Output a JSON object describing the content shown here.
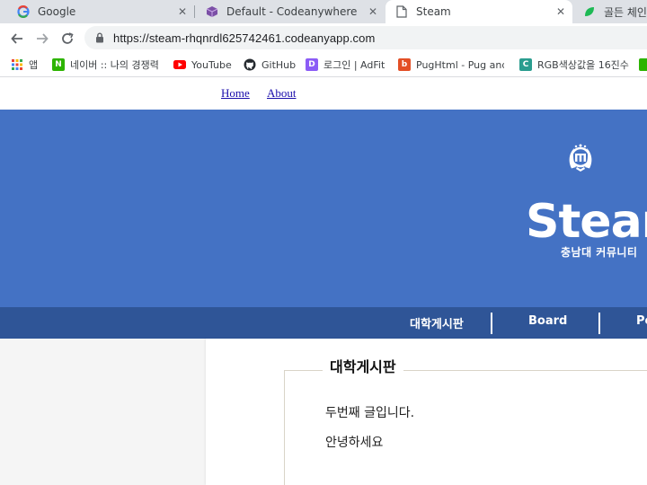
{
  "browser": {
    "tabs": [
      {
        "title": "Google",
        "favicon": "google-icon"
      },
      {
        "title": "Default - Codeanywhere",
        "favicon": "codeanywhere-cube-icon"
      },
      {
        "title": "Steam",
        "favicon": "document-icon",
        "active": true
      },
      {
        "title": "골든 체인지",
        "favicon": "green-leaf-icon"
      }
    ],
    "close_glyph": "✕",
    "url": "https://steam-rhqnrdl625742461.codeanyapp.com",
    "bookmarks": [
      {
        "label": "앱",
        "icon": "apps-grid-icon"
      },
      {
        "label": "네이버 :: 나의 경쟁력",
        "icon": "naver-icon",
        "icon_text": "N",
        "color": "#2db400"
      },
      {
        "label": "YouTube",
        "icon": "youtube-icon",
        "color": "#ff0000"
      },
      {
        "label": "GitHub",
        "icon": "github-icon",
        "color": "#24292e"
      },
      {
        "label": "로그인 | AdFit",
        "icon": "adfit-icon",
        "icon_text": "D",
        "color": "#8b5cf6"
      },
      {
        "label": "PugHtml - Pug and",
        "icon": "pughtml-icon",
        "icon_text": "b",
        "color": "#e34f26"
      },
      {
        "label": "RGB색상값을 16진수",
        "icon": "rgb-converter-icon",
        "icon_text": "C",
        "color": "#2a9d8f"
      }
    ]
  },
  "site": {
    "top_nav": [
      {
        "label": "Home"
      },
      {
        "label": "About"
      }
    ],
    "logo": {
      "title": "Steam",
      "subtitle": "충남대 커뮤니티",
      "emblem_text": "m"
    },
    "menu": [
      {
        "label": "대학게시판"
      },
      {
        "label": "Board"
      },
      {
        "label": "Po"
      }
    ],
    "board": {
      "legend": "대학게시판",
      "lines": [
        "두번째 글입니다.",
        "안녕하세요"
      ]
    },
    "colors": {
      "banner": "#4472c4",
      "menubar": "#2f5597"
    }
  }
}
